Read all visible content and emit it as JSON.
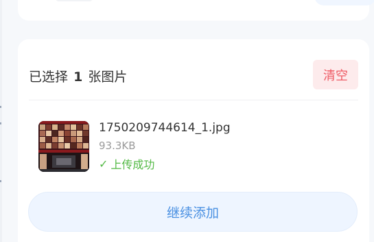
{
  "selection": {
    "prefix": "已选择",
    "count": "1",
    "suffix": "张图片",
    "clear_label": "清空"
  },
  "files": [
    {
      "name": "1750209744614_1.jpg",
      "size": "93.3KB",
      "status_icon": "✓",
      "status": "上传成功"
    }
  ],
  "actions": {
    "continue_label": "继续添加"
  },
  "colors": {
    "accent": "#4a90e2",
    "success": "#52b944",
    "danger": "#ee5a64",
    "danger_bg": "#fdebec",
    "button_bg": "#eef5ff"
  }
}
